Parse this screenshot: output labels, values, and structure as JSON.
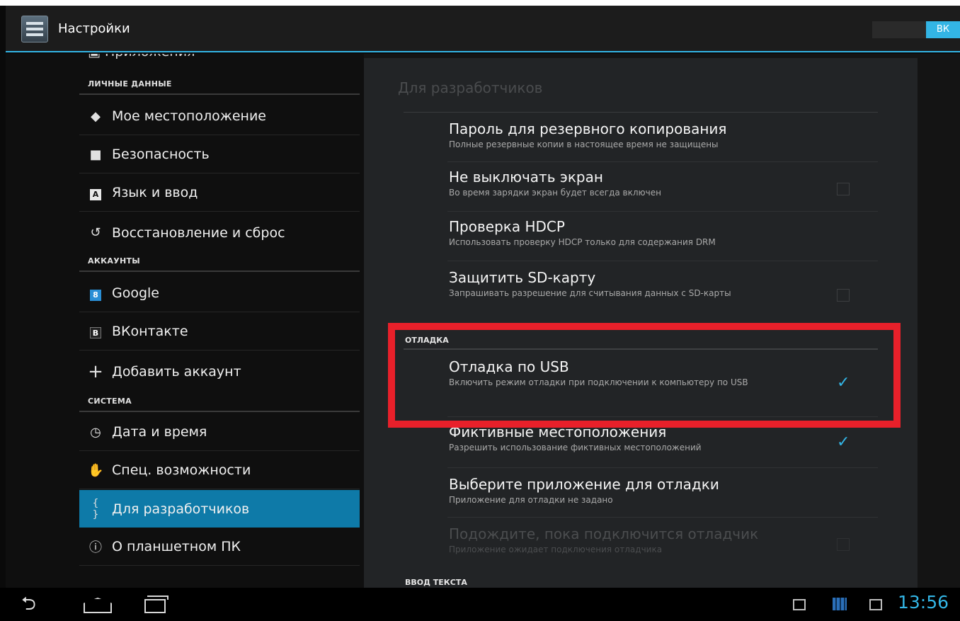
{
  "actionbar": {
    "title": "Настройки",
    "switch_label": "ВК"
  },
  "sidebar": {
    "partial_item": "Приложения",
    "headers": {
      "personal": "ЛИЧНЫЕ ДАННЫЕ",
      "accounts": "АККАУНТЫ",
      "system": "СИСТЕМА"
    },
    "items": [
      {
        "icon": "location-icon",
        "glyph": "◆",
        "label": "Мое местоположение"
      },
      {
        "icon": "lock-icon",
        "glyph": "🔒",
        "label": "Безопасность"
      },
      {
        "icon": "keyboard-icon",
        "glyph": "A",
        "label": "Язык и ввод"
      },
      {
        "icon": "restore-icon",
        "glyph": "↺",
        "label": "Восстановление и сброс"
      },
      {
        "icon": "google-icon",
        "glyph": "8",
        "label": "Google"
      },
      {
        "icon": "vk-icon",
        "glyph": "B",
        "label": "ВКонтакте"
      },
      {
        "icon": "plus-icon",
        "glyph": "+",
        "label": "Добавить аккаунт"
      },
      {
        "icon": "clock-icon",
        "glyph": "◷",
        "label": "Дата и время"
      },
      {
        "icon": "hand-icon",
        "glyph": "✋",
        "label": "Спец. возможности"
      },
      {
        "icon": "braces-icon",
        "glyph": "{ }",
        "label": "Для разработчиков"
      },
      {
        "icon": "info-icon",
        "glyph": "ⓘ",
        "label": "О планшетном ПК"
      }
    ]
  },
  "panel": {
    "title": "Для разработчиков",
    "prefs": [
      {
        "title": "Пароль для резервного копирования",
        "summary": "Полные резервные копии в настоящее время не защищены"
      },
      {
        "title": "Не выключать экран",
        "summary": "Во время зарядки экран будет всегда включен"
      },
      {
        "title": "Проверка HDCP",
        "summary": "Использовать проверку HDCP только для содержания DRM"
      },
      {
        "title": "Защитить SD-карту",
        "summary": "Запрашивать разрешение для считывания данных с SD-карты"
      },
      {
        "title": "Отладка по USB",
        "summary": "Включить режим отладки при подключении к компьютеру по USB"
      },
      {
        "title": "Фиктивные местоположения",
        "summary": "Разрешить использование фиктивных местоположений"
      },
      {
        "title": "Выберите приложение для отладки",
        "summary": "Приложение для отладки не задано"
      },
      {
        "title": "Подождите, пока подключится отладчик",
        "summary": "Приложение ожидает подключения отладчика"
      }
    ],
    "sections": {
      "debug": "ОТЛАДКА",
      "text_input": "ВВОД ТЕКСТА"
    },
    "checkmark": "✓"
  },
  "statusbar": {
    "time": "13:56"
  },
  "colors": {
    "accent": "#33b5e5",
    "selected": "#0e7aa8",
    "highlight": "#e8202a"
  }
}
